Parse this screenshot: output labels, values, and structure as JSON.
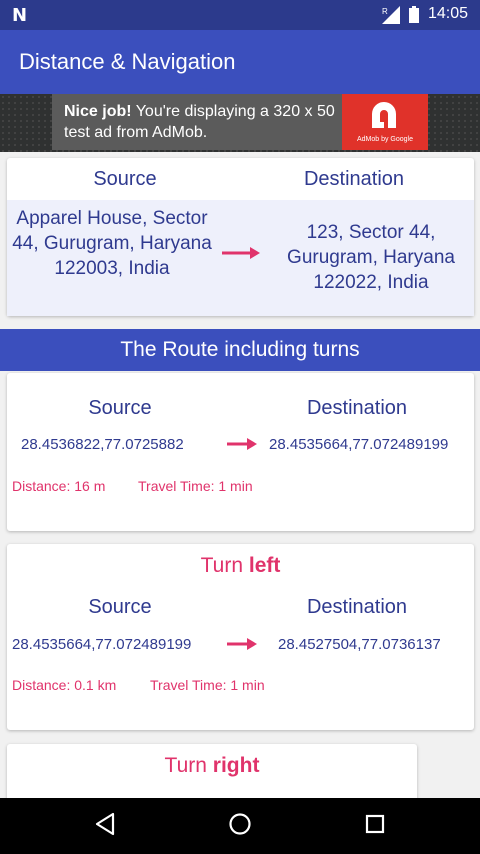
{
  "status": {
    "time": "14:05",
    "roaming": "R"
  },
  "appbar": {
    "title": "Distance & Navigation"
  },
  "ad": {
    "bold": "Nice job!",
    "text": " You're displaying a 320 x 50 test ad from AdMob.",
    "logo_caption": "AdMob by Google"
  },
  "summary": {
    "source_label": "Source",
    "destination_label": "Destination",
    "source": "Apparel House, Sector 44, Gurugram, Haryana 122003, India",
    "destination": "123, Sector 44, Gurugram, Haryana 122022, India"
  },
  "banner": "The Route including turns",
  "steps": [
    {
      "turn_prefix": "",
      "turn_dir": "",
      "source_label": "Source",
      "destination_label": "Destination",
      "source": "28.4536822,77.0725882",
      "destination": "28.4535664,77.072489199",
      "distance": "Distance: 16 m",
      "time": "Travel Time: 1 min"
    },
    {
      "turn_prefix": "Turn ",
      "turn_dir": "left",
      "source_label": "Source",
      "destination_label": "Destination",
      "source": "28.4535664,77.072489199",
      "destination": "28.4527504,77.0736137",
      "distance": "Distance: 0.1 km",
      "time": "Travel Time: 1 min"
    },
    {
      "turn_prefix": "Turn ",
      "turn_dir": "right"
    }
  ],
  "colors": {
    "primary": "#3b4fbd",
    "primary_dark": "#2c3a8c",
    "accent": "#e0336b",
    "text": "#2f3a8f"
  }
}
